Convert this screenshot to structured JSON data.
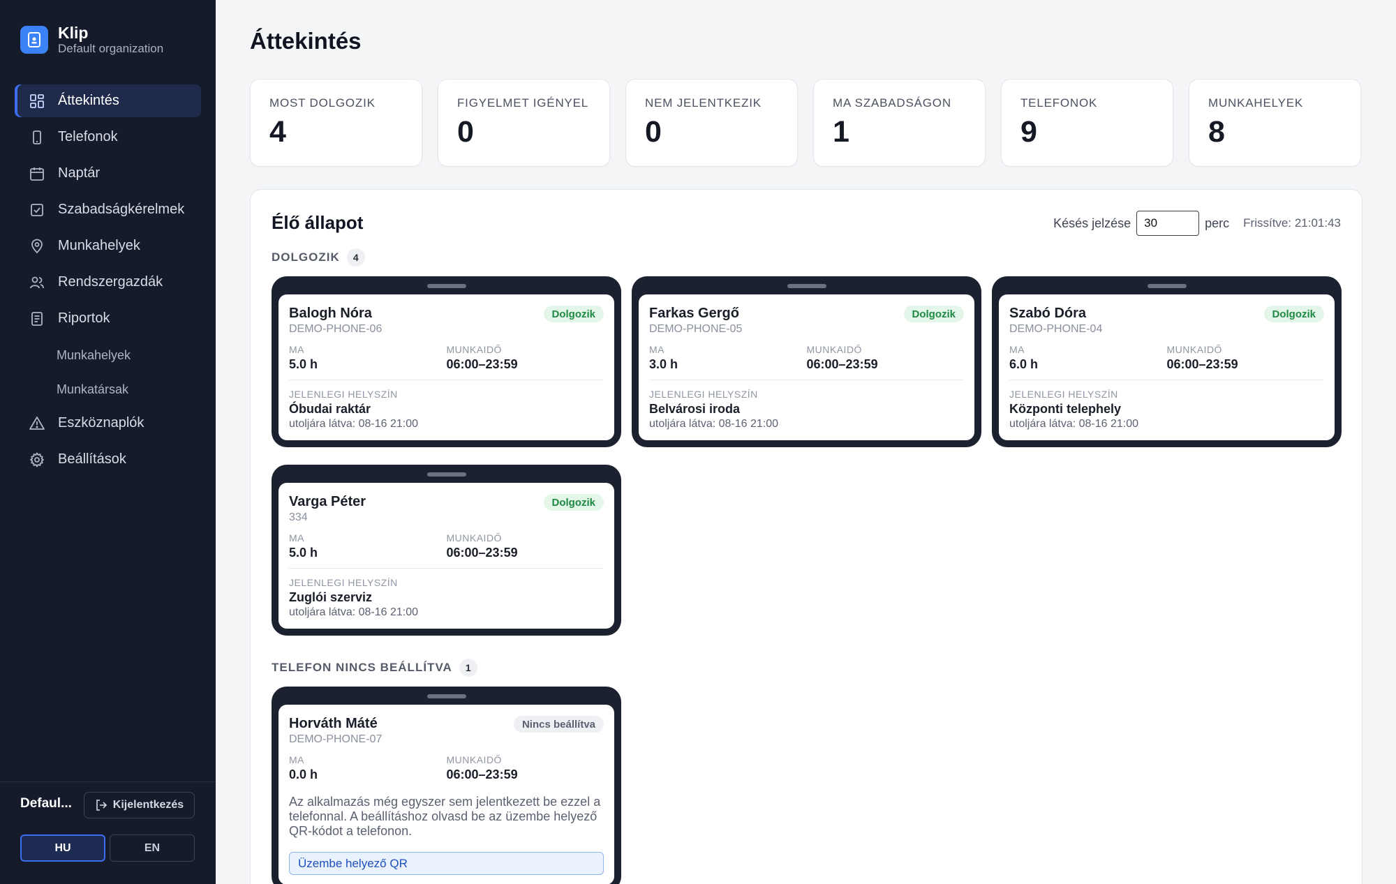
{
  "brand": {
    "name": "Klip",
    "org": "Default organization"
  },
  "nav": {
    "items": [
      {
        "label": "Áttekintés",
        "icon": "dashboard-icon"
      },
      {
        "label": "Telefonok",
        "icon": "phone-icon"
      },
      {
        "label": "Naptár",
        "icon": "calendar-icon"
      },
      {
        "label": "Szabadságkérelmek",
        "icon": "check-square-icon"
      },
      {
        "label": "Munkahelyek",
        "icon": "map-pin-icon"
      },
      {
        "label": "Rendszergazdák",
        "icon": "users-icon"
      },
      {
        "label": "Riportok",
        "icon": "report-icon"
      }
    ],
    "sub_items": [
      "Munkahelyek",
      "Munkatársak"
    ],
    "tail_items": [
      {
        "label": "Eszköznaplók",
        "icon": "warning-icon"
      },
      {
        "label": "Beállítások",
        "icon": "gear-icon"
      }
    ]
  },
  "footer": {
    "user": "Defaul...",
    "logout": "Kijelentkezés",
    "lang_hu": "HU",
    "lang_en": "EN",
    "active_lang": "HU"
  },
  "page": {
    "title": "Áttekintés"
  },
  "stats": [
    {
      "label": "MOST DOLGOZIK",
      "value": "4"
    },
    {
      "label": "FIGYELMET IGÉNYEL",
      "value": "0"
    },
    {
      "label": "NEM JELENTKEZIK",
      "value": "0"
    },
    {
      "label": "MA SZABADSÁGON",
      "value": "1"
    },
    {
      "label": "TELEFONOK",
      "value": "9"
    },
    {
      "label": "MUNKAHELYEK",
      "value": "8"
    }
  ],
  "live": {
    "title": "Élő állapot",
    "delay_label": "Késés jelzése",
    "delay_value": "30",
    "delay_unit": "perc",
    "refreshed": "Frissítve: 21:01:43"
  },
  "sections": {
    "working": {
      "label": "DOLGOZIK",
      "count": "4"
    },
    "no_phone": {
      "label": "TELEFON NINCS BEÁLLÍTVA",
      "count": "1"
    }
  },
  "labels": {
    "today": "MA",
    "worktime": "MUNKAIDŐ",
    "location": "JELENLEGI HELYSZÍN"
  },
  "working_cards": [
    {
      "name": "Balogh Nóra",
      "device": "DEMO-PHONE-06",
      "status": "Dolgozik",
      "today": "5.0 h",
      "worktime": "06:00–23:59",
      "location": "Óbudai raktár",
      "seen": "utoljára látva: 08-16 21:00"
    },
    {
      "name": "Farkas Gergő",
      "device": "DEMO-PHONE-05",
      "status": "Dolgozik",
      "today": "3.0 h",
      "worktime": "06:00–23:59",
      "location": "Belvárosi iroda",
      "seen": "utoljára látva: 08-16 21:00"
    },
    {
      "name": "Szabó Dóra",
      "device": "DEMO-PHONE-04",
      "status": "Dolgozik",
      "today": "6.0 h",
      "worktime": "06:00–23:59",
      "location": "Központi telephely",
      "seen": "utoljára látva: 08-16 21:00"
    },
    {
      "name": "Varga Péter",
      "device": "334",
      "status": "Dolgozik",
      "today": "5.0 h",
      "worktime": "06:00–23:59",
      "location": "Zuglói szerviz",
      "seen": "utoljára látva: 08-16 21:00"
    }
  ],
  "notset_card": {
    "name": "Horváth Máté",
    "device": "DEMO-PHONE-07",
    "status": "Nincs beállítva",
    "today": "0.0 h",
    "worktime": "06:00–23:59",
    "notice": "Az alkalmazás még egyszer sem jelentkezett be ezzel a telefonnal. A beállításhoz olvasd be az üzembe helyező QR-kódot a telefonon.",
    "qr_button": "Üzembe helyező QR"
  }
}
